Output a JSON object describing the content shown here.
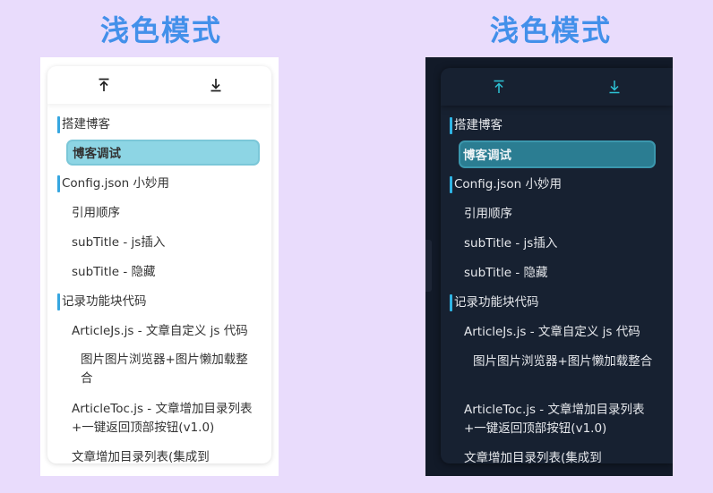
{
  "headings": {
    "left": "浅色模式",
    "right": "浅色模式"
  },
  "toolbar": {
    "top_icon": "arrow-up-to-top-icon",
    "bottom_icon": "arrow-down-to-bottom-icon"
  },
  "toc": {
    "i0": "搭建博客",
    "i1": "博客调试",
    "i2": "Config.json 小妙用",
    "i3": "引用顺序",
    "i4": "subTitle - js插入",
    "i5": "subTitle - 隐藏",
    "i6": "记录功能块代码",
    "i7": "ArticleJs.js - 文章自定义 js 代码",
    "i8": "图片图片浏览器+图片懒加载整合",
    "i9": "ArticleToc.js - 文章增加目录列表+一键返回顶部按钮(v1.0)",
    "i10": "文章增加目录列表(集成到"
  },
  "colors": {
    "page_bg": "#e9dcfc",
    "heading": "#4390ea",
    "accent_bar": "#36a6e0",
    "light_active": "#8dd5e4",
    "dark_active": "#2b7d92",
    "dark_icon": "#2ec3d6"
  }
}
